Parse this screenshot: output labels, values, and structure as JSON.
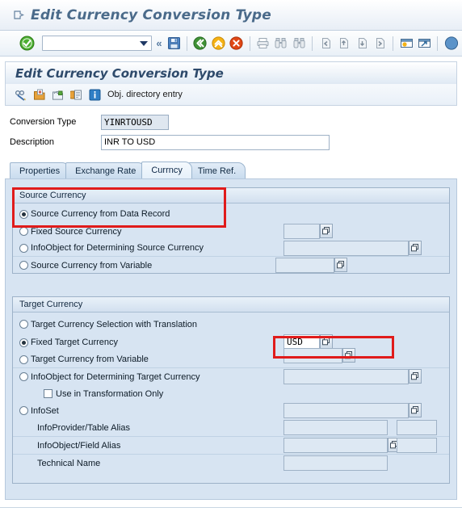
{
  "window": {
    "title": "Edit Currency Conversion Type",
    "back_icon": "back-arrow-icon"
  },
  "toolbar": {
    "ok_icon": "green-check-icon",
    "command_field_value": "",
    "command_field_placeholder": "",
    "dropdown_icon": "chevron-down-icon",
    "expand_icon": "«",
    "buttons": [
      {
        "name": "save-button",
        "icon": "save-disk-icon",
        "tooltip": "Save"
      },
      {
        "name": "back-button",
        "icon": "green-back-icon",
        "tooltip": "Back"
      },
      {
        "name": "exit-button",
        "icon": "yellow-up-icon",
        "tooltip": "Exit"
      },
      {
        "name": "cancel-button",
        "icon": "red-cancel-icon",
        "tooltip": "Cancel"
      },
      {
        "name": "print-button",
        "icon": "printer-icon",
        "tooltip": "Print"
      },
      {
        "name": "find-button",
        "icon": "binoculars-icon",
        "tooltip": "Find"
      },
      {
        "name": "find-next-button",
        "icon": "binoculars-plus-icon",
        "tooltip": "Find Next"
      },
      {
        "name": "first-page-button",
        "icon": "first-page-icon",
        "tooltip": "First Page"
      },
      {
        "name": "previous-page-button",
        "icon": "previous-page-icon",
        "tooltip": "Previous Page"
      },
      {
        "name": "next-page-button",
        "icon": "next-page-icon",
        "tooltip": "Next Page"
      },
      {
        "name": "last-page-button",
        "icon": "last-page-icon",
        "tooltip": "Last Page"
      },
      {
        "name": "create-session-button",
        "icon": "new-session-icon",
        "tooltip": "Create New Session"
      },
      {
        "name": "create-shortcut-button",
        "icon": "shortcut-icon",
        "tooltip": "Create Shortcut"
      },
      {
        "name": "help-button",
        "icon": "help-icon",
        "tooltip": "Help"
      }
    ]
  },
  "screen": {
    "title": "Edit Currency Conversion Type",
    "appbar": {
      "icons": [
        {
          "name": "display-change-icon",
          "label": "glasses-pencil-icon"
        },
        {
          "name": "create-icon",
          "label": "folder-new-icon"
        },
        {
          "name": "change-icon",
          "label": "folder-green-icon"
        },
        {
          "name": "copy-icon",
          "label": "copy-pages-icon"
        },
        {
          "name": "info-icon",
          "label": "blue-info-icon"
        }
      ],
      "obj_directory_label": "Obj. directory entry"
    }
  },
  "header_fields": {
    "conversion_type": {
      "label": "Conversion Type",
      "value": "YINRTOUSD"
    },
    "description": {
      "label": "Description",
      "value": "INR TO USD"
    }
  },
  "tabs": [
    {
      "label": "Properties",
      "active": false
    },
    {
      "label": "Exchange Rate",
      "active": false
    },
    {
      "label": "Currncy",
      "active": true
    },
    {
      "label": "Time Ref.",
      "active": false
    }
  ],
  "source_currency": {
    "group_title": "Source Currency",
    "options": [
      {
        "label": "Source Currency from Data Record",
        "selected": true,
        "has_field": false
      },
      {
        "label": "Fixed Source Currency",
        "selected": false,
        "has_field": true,
        "field_value": ""
      },
      {
        "label": "InfoObject for Determining Source Currency",
        "selected": false,
        "has_field": true,
        "field_value": ""
      },
      {
        "label": "Source Currency from Variable",
        "selected": false,
        "has_field": true,
        "field_value": ""
      }
    ]
  },
  "target_currency": {
    "group_title": "Target Currency",
    "options": [
      {
        "label": "Target Currency Selection with Translation",
        "selected": false,
        "has_field": false
      },
      {
        "label": "Fixed Target Currency",
        "selected": true,
        "has_field": true,
        "field_value": "USD"
      },
      {
        "label": "Target Currency from Variable",
        "selected": false,
        "has_field": true,
        "field_value": ""
      },
      {
        "label": "InfoObject for Determining Target Currency",
        "selected": false,
        "has_field": true,
        "field_value": ""
      },
      {
        "label": "InfoSet",
        "selected": false,
        "has_field": true,
        "field_value": ""
      }
    ],
    "checkbox": {
      "label": "Use in Transformation Only",
      "checked": false
    },
    "sub_fields": [
      {
        "label": "InfoProvider/Table Alias",
        "value": "",
        "has_f4": false,
        "has_extra": true
      },
      {
        "label": "InfoObject/Field Alias",
        "value": "",
        "has_f4": true,
        "has_extra": true
      },
      {
        "label": "Technical Name",
        "value": "",
        "has_f4": false,
        "has_extra": false
      }
    ]
  },
  "annotations": {
    "highlight_color": "#e01b1b",
    "boxes": [
      {
        "name": "source-currency-highlight",
        "target": "Source Currency from Data Record"
      },
      {
        "name": "fixed-target-currency-highlight",
        "target": "USD"
      }
    ]
  },
  "icons": {
    "f4_help": "value-help-icon"
  }
}
